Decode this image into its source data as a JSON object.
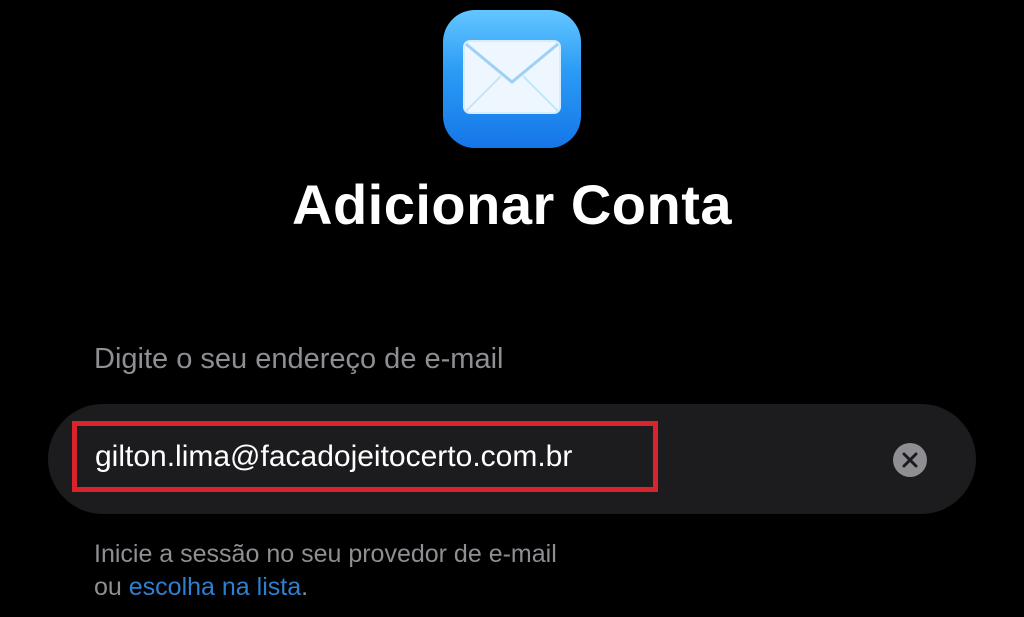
{
  "app": {
    "icon": "mail-icon",
    "accent_color": "#2a9bf5"
  },
  "title": "Adicionar Conta",
  "email_field": {
    "label": "Digite o seu endereço de e-mail",
    "value": "gilton.lima@facadojeitocerto.com.br",
    "highlight_color": "#d9232d",
    "clear_icon": "clear-icon"
  },
  "hint": {
    "line1": "Inicie a sessão no seu provedor de e-mail",
    "prefix": "ou",
    "link_text": "escolha na lista",
    "suffix": ".",
    "link_color": "#2f7fd1"
  }
}
